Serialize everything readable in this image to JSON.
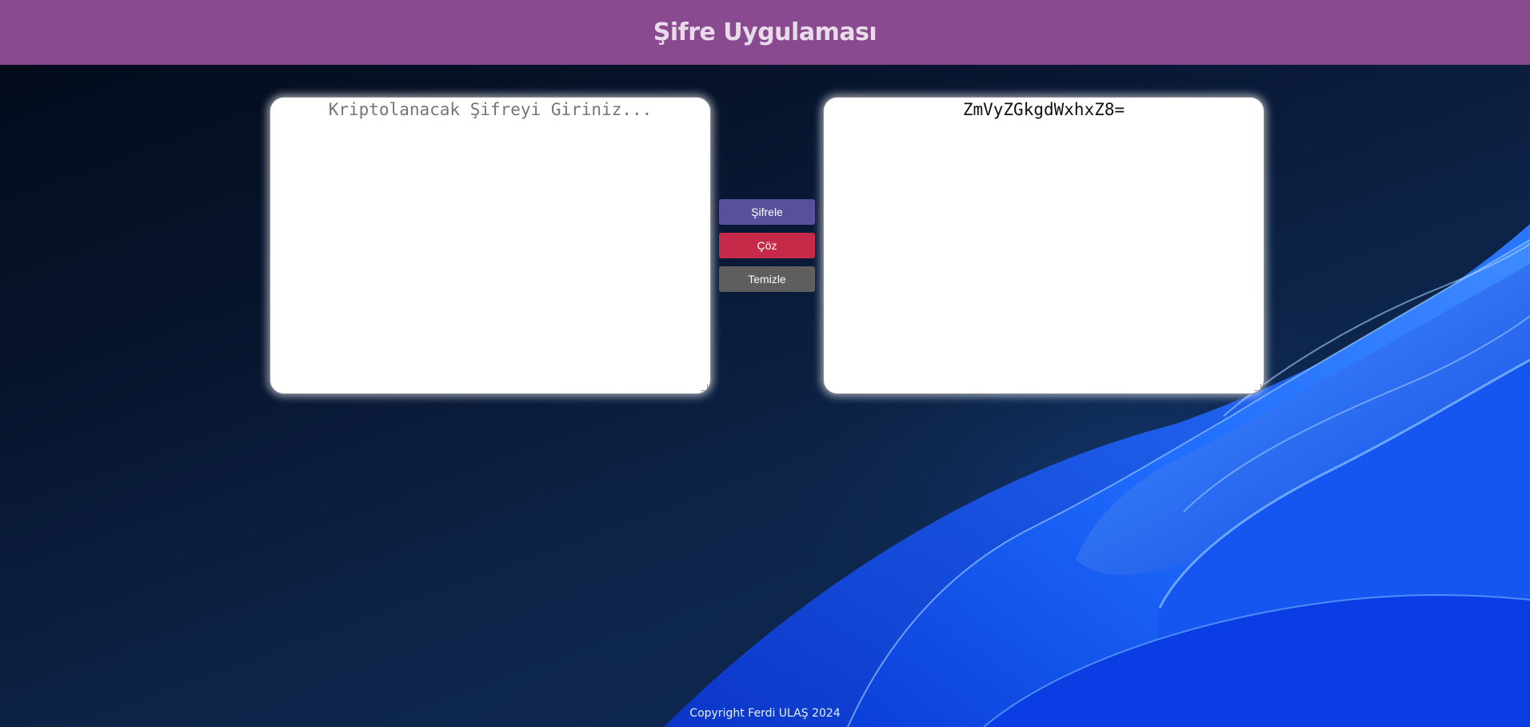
{
  "header": {
    "title": "Şifre Uygulaması"
  },
  "input_panel": {
    "placeholder": "Kriptolanacak Şifreyi Giriniz...",
    "value": ""
  },
  "output_panel": {
    "value": "ZmVyZGkgdWxhxZ8="
  },
  "buttons": {
    "encrypt_label": "Şifrele",
    "decrypt_label": "Çöz",
    "clear_label": "Temizle"
  },
  "footer": {
    "copyright": "Copyright Ferdi ULAŞ 2024"
  },
  "colors": {
    "header_bg": "#8a4a8f",
    "encrypt_button": "#56519a",
    "decrypt_button": "#c62a48",
    "clear_button": "#5e5e5e"
  }
}
